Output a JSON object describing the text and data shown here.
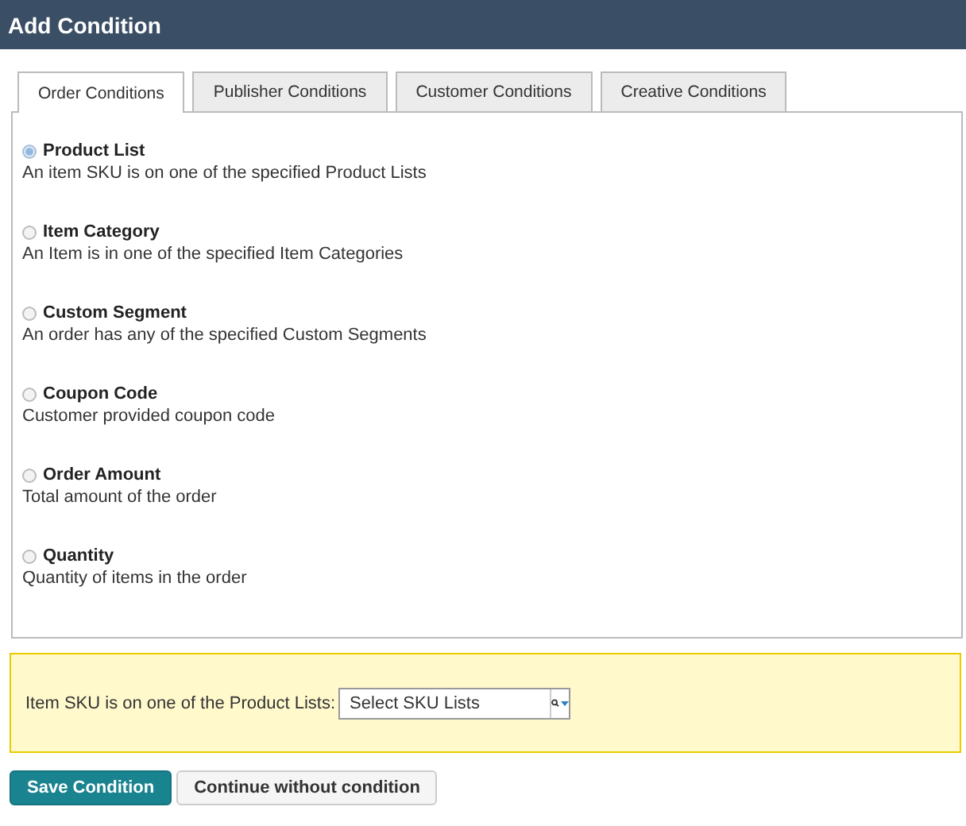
{
  "window": {
    "title": "Add Condition"
  },
  "tabs": [
    {
      "label": "Order Conditions",
      "selected": true
    },
    {
      "label": "Publisher Conditions",
      "selected": false
    },
    {
      "label": "Customer Conditions",
      "selected": false
    },
    {
      "label": "Creative Conditions",
      "selected": false
    }
  ],
  "options": [
    {
      "title": "Product List",
      "description": "An item SKU is on one of the specified Product Lists",
      "selected": true
    },
    {
      "title": "Item Category",
      "description": "An Item is in one of the specified Item Categories",
      "selected": false
    },
    {
      "title": "Custom Segment",
      "description": "An order has any of the specified Custom Segments",
      "selected": false
    },
    {
      "title": "Coupon Code",
      "description": "Customer provided coupon code",
      "selected": false
    },
    {
      "title": "Order Amount",
      "description": "Total amount of the order",
      "selected": false
    },
    {
      "title": "Quantity",
      "description": "Quantity of items in the order",
      "selected": false
    }
  ],
  "detail": {
    "label": "Item SKU is on one of the Product Lists:",
    "select": {
      "placeholder": "Select SKU Lists"
    }
  },
  "buttons": [
    {
      "label": "Save Condition",
      "kind": "primary"
    },
    {
      "label": "Continue without condition",
      "kind": "secondary"
    }
  ]
}
